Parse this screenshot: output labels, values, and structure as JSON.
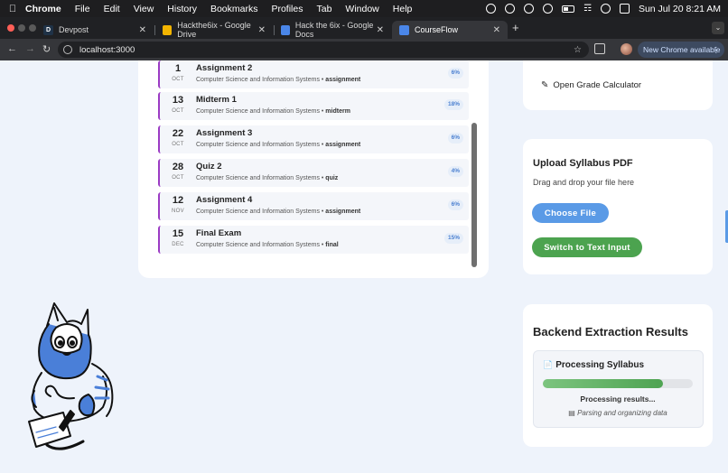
{
  "menubar": {
    "app": "Chrome",
    "items": [
      "File",
      "Edit",
      "View",
      "History",
      "Bookmarks",
      "Profiles",
      "Tab",
      "Window",
      "Help"
    ],
    "datetime": "Sun Jul 20  8:21 AM"
  },
  "tabs": [
    {
      "title": "Devpost",
      "favicon": "devpost-icon",
      "color": "#1f3247",
      "letter": "D"
    },
    {
      "title": "Hackthe6ix - Google Drive",
      "favicon": "google-drive-icon",
      "color": "#f2b400",
      "letter": ""
    },
    {
      "title": "Hack the 6ix - Google Docs",
      "favicon": "google-docs-icon",
      "color": "#4a86e8",
      "letter": ""
    },
    {
      "title": "CourseFlow",
      "favicon": "courseflow-icon",
      "color": "#4a86e8",
      "letter": ""
    }
  ],
  "toolbar": {
    "url": "localhost:3000",
    "update_label": "New Chrome available"
  },
  "deadlines": [
    {
      "day": "1",
      "month": "OCT",
      "title": "Assignment 2",
      "course": "Computer Science and Information Systems",
      "type": "assignment",
      "weight": "6%"
    },
    {
      "day": "13",
      "month": "OCT",
      "title": "Midterm 1",
      "course": "Computer Science and Information Systems",
      "type": "midterm",
      "weight": "18%"
    },
    {
      "day": "22",
      "month": "OCT",
      "title": "Assignment 3",
      "course": "Computer Science and Information Systems",
      "type": "assignment",
      "weight": "6%"
    },
    {
      "day": "28",
      "month": "OCT",
      "title": "Quiz 2",
      "course": "Computer Science and Information Systems",
      "type": "quiz",
      "weight": "4%"
    },
    {
      "day": "12",
      "month": "NOV",
      "title": "Assignment 4",
      "course": "Computer Science and Information Systems",
      "type": "assignment",
      "weight": "6%"
    },
    {
      "day": "15",
      "month": "DEC",
      "title": "Final Exam",
      "course": "Computer Science and Information Systems",
      "type": "final",
      "weight": "15%"
    }
  ],
  "grade_calculator": {
    "label": "Open Grade Calculator"
  },
  "upload": {
    "title": "Upload Syllabus PDF",
    "subtitle": "Drag and drop your file here",
    "choose_label": "Choose File",
    "switch_label": "Switch to Text Input"
  },
  "results": {
    "title": "Backend Extraction Results",
    "processing_title": "Processing Syllabus",
    "progress": 0.8,
    "status": "Processing results...",
    "detail": "Parsing and organizing data"
  },
  "colors": {
    "accent_purple": "#9b3bc4",
    "primary_blue": "#5a9ae6",
    "success_green": "#4ca34f",
    "page_bg": "#eef3fb"
  }
}
